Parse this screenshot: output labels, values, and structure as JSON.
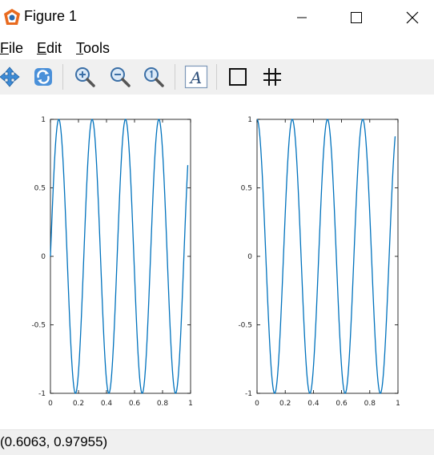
{
  "window": {
    "title": "Figure 1"
  },
  "menu": {
    "file": "File",
    "edit": "Edit",
    "tools": "Tools"
  },
  "toolbar": {
    "icons": [
      "pan-icon",
      "rotate-icon",
      "zoom-in-icon",
      "zoom-out-icon",
      "zoom-reset-icon",
      "insert-text-icon",
      "toggle-axes-box-icon",
      "toggle-grid-icon"
    ]
  },
  "status": {
    "coordinates": "(0.6063, 0.97955)"
  },
  "chart_data": [
    {
      "type": "line",
      "xlim": [
        0,
        1
      ],
      "ylim": [
        -1,
        1
      ],
      "x_ticks": [
        "0",
        "0.2",
        "0.4",
        "0.6",
        "0.8",
        "1"
      ],
      "y_ticks": [
        "1",
        "0.5",
        "0",
        "-0.5",
        "-1"
      ],
      "series": [
        {
          "function": "sin(2*pi*4.2*x)",
          "color": "#0072bd",
          "x_start": 0,
          "x_end": 0.98
        }
      ],
      "grid": false
    },
    {
      "type": "line",
      "xlim": [
        0,
        1
      ],
      "ylim": [
        -1,
        1
      ],
      "x_ticks": [
        "0",
        "0.2",
        "0.4",
        "0.6",
        "0.8",
        "1"
      ],
      "y_ticks": [
        "1",
        "0.5",
        "0",
        "-0.5",
        "-1"
      ],
      "series": [
        {
          "function": "cos(2*pi*4*x)",
          "color": "#0072bd",
          "x_start": 0,
          "x_end": 0.98
        }
      ],
      "grid": false
    }
  ]
}
